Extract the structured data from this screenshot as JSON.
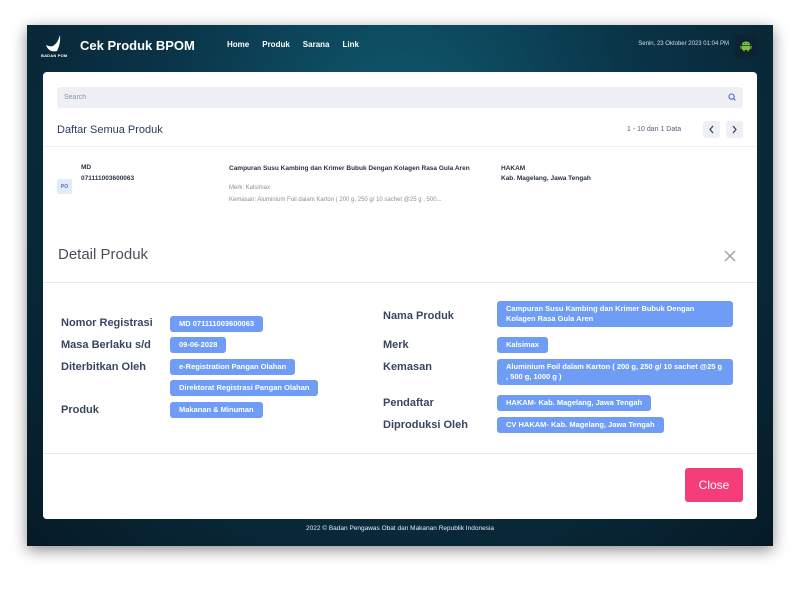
{
  "header": {
    "title": "Cek Produk BPOM",
    "logo_text": "BADAN POM",
    "nav": [
      "Home",
      "Produk",
      "Sarana",
      "Link"
    ],
    "datetime": "Senin, 23 Oktober 2023 01:04 PM"
  },
  "search": {
    "placeholder": "Search"
  },
  "list": {
    "title": "Daftar Semua Produk",
    "pagination": "1 - 10 dari 1 Data",
    "item": {
      "badge": "PO",
      "reg_label": "MD",
      "reg_number": "071111003600063",
      "name": "Campuran Susu Kambing dan Krimer Bubuk Dengan Kolagen Rasa Gula Aren",
      "merk": "Merk: Kalsimax",
      "kemasan": "Kemasan: Aluminium Foil dalam Karton ( 200 g, 250 g/ 10 sachet @25 g , 500...",
      "company": "HAKAM",
      "location": "Kab. Magelang, Jawa Tengah"
    }
  },
  "modal": {
    "title": "Detail Produk",
    "labels": {
      "nomor_registrasi": "Nomor Registrasi",
      "masa_berlaku": "Masa Berlaku s/d",
      "diterbitkan_oleh": "Diterbitkan Oleh",
      "produk": "Produk",
      "nama_produk": "Nama Produk",
      "merk": "Merk",
      "kemasan": "Kemasan",
      "pendaftar": "Pendaftar",
      "diproduksi_oleh": "Diproduksi Oleh"
    },
    "values": {
      "nomor_registrasi": "MD 071111003600063",
      "masa_berlaku": "09-06-2028",
      "diterbitkan_oleh_1": "e-Registration Pangan Olahan",
      "diterbitkan_oleh_2": "Direktorat Registrasi Pangan Olahan",
      "produk": "Makanan & Minuman",
      "nama_produk": "Campuran Susu Kambing dan Krimer Bubuk Dengan Kolagen Rasa Gula Aren",
      "merk": "Kalsimax",
      "kemasan": "Aluminium Foil dalam Karton ( 200 g, 250 g/ 10 sachet @25 g , 500 g, 1000 g )",
      "pendaftar": "HAKAM- Kab. Magelang, Jawa Tengah",
      "diproduksi_oleh": "CV HAKAM- Kab. Magelang, Jawa Tengah"
    },
    "close_label": "Close"
  },
  "footer": "2022 ©  Badan Pengawas Obat dan Makanan Republik Indonesia",
  "colors": {
    "pill": "#6f9cf5",
    "close_button": "#f53d7a",
    "background_dark": "#0a3448"
  }
}
